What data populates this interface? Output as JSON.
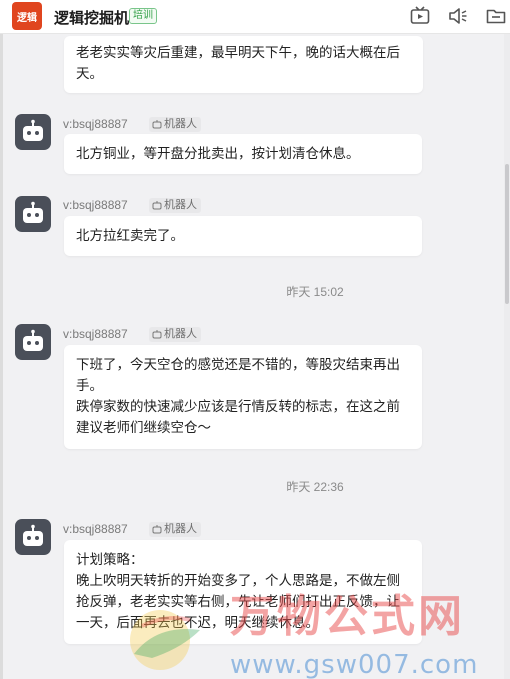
{
  "app": {
    "logo_text": "逻辑",
    "title": "逻辑挖掘机",
    "badge": "培训"
  },
  "toolbar": {
    "icons": [
      "tv-icon",
      "speaker-icon",
      "folder-icon"
    ]
  },
  "messages": [
    {
      "lines": [
        "老老实实等灾后重建，最早明天下午，晚的话大概在后",
        "天。"
      ]
    },
    {
      "sender": "v:bsqj88887",
      "tag": "机器人",
      "lines": [
        "北方铜业，等开盘分批卖出，按计划清仓休息。"
      ]
    },
    {
      "sender": "v:bsqj88887",
      "tag": "机器人",
      "lines": [
        "北方拉红卖完了。"
      ]
    },
    {
      "timestamp": "昨天 15:02"
    },
    {
      "sender": "v:bsqj88887",
      "tag": "机器人",
      "lines": [
        "下班了，今天空仓的感觉还是不错的，等股灾结束再出",
        "手。",
        "跌停家数的快速减少应该是行情反转的标志，在这之前",
        "建议老师们继续空仓～"
      ]
    },
    {
      "timestamp": "昨天 22:36"
    },
    {
      "sender": "v:bsqj88887",
      "tag": "机器人",
      "lines": [
        "计划策略：",
        "晚上吹明天转折的开始变多了，个人思路是，不做左侧",
        "抢反弹，老老实实等右侧，先让老师们打出正反馈，让",
        "一天，后面再去也不迟，明天继续休息。"
      ]
    }
  ],
  "watermark": {
    "text": "万物公式网",
    "url": "www.gsw007.com"
  }
}
